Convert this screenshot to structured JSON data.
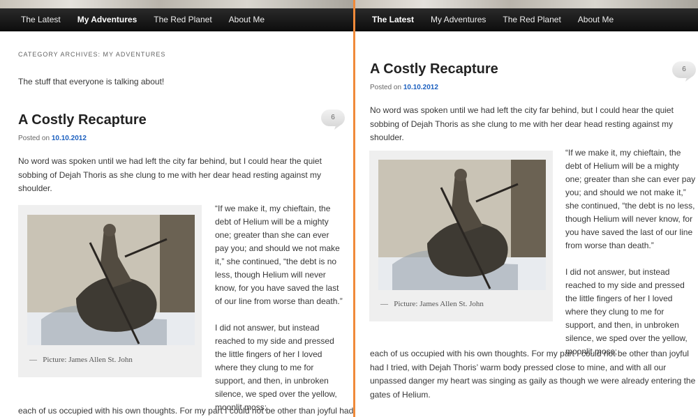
{
  "nav": {
    "items": [
      "The Latest",
      "My Adventures",
      "The Red Planet",
      "About Me"
    ]
  },
  "left": {
    "active_nav": "My Adventures",
    "archive_title": "Category Archives: My Adventures",
    "archive_description": "The stuff that everyone is talking about!"
  },
  "right": {
    "active_nav": "The Latest"
  },
  "post": {
    "title": "A Costly Recapture",
    "posted_on_label": "Posted on",
    "date": "10.10.2012",
    "comment_count": "6",
    "intro": "No word was spoken until we had left the city far behind, but I could hear the quiet sobbing of Dejah Thoris as she clung to me with her dear head resting against my shoulder.",
    "quote": "“If we make it, my chieftain, the debt of Helium will be a mighty one; greater than she can ever pay you; and should we not make it,” she continued, “the debt is no less, though Helium will never know, for you have saved the last of our line from worse than death.”",
    "para2_side": "I did not answer, but instead reached to my side and pressed the little fingers of her I loved where they clung to me for support, and then, in unbroken silence, we sped over the yellow, moonlit moss;",
    "para2_left_bottom": "each of us occupied with his own thoughts. For my part I could not be other than joyful had",
    "para2_right_bottom": "each of us occupied with his own thoughts. For my part I could not be other than joyful had I tried, with Dejah Thoris’ warm body pressed close to mine, and with all our unpassed danger my heart was singing as gaily as though we were already entering the gates of Helium.",
    "caption_dash": "—",
    "caption": "Picture: James Allen St. John"
  },
  "colors": {
    "divider": "#f08a3a",
    "link": "#1b5fbf",
    "nav_bg": "#111111"
  }
}
